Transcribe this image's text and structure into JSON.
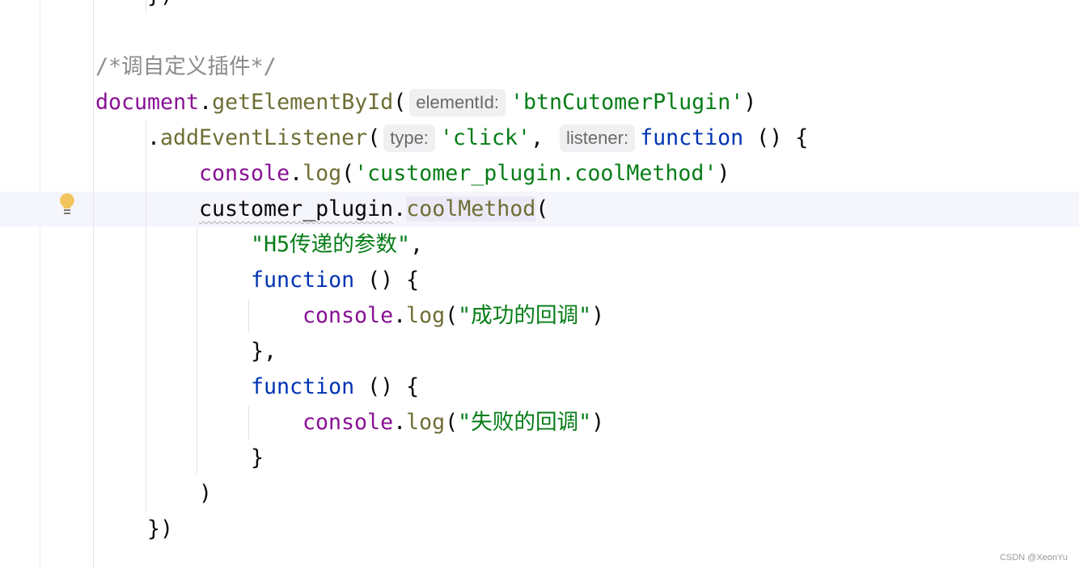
{
  "editor": {
    "current_line_index": 5,
    "lines": [
      {
        "indent": 1,
        "tokens": [
          {
            "t": "})",
            "c": ""
          }
        ]
      },
      {
        "indent": 0,
        "tokens": []
      },
      {
        "indent": 0,
        "tokens": [
          {
            "t": "/*调自定义插件*/",
            "c": "cm"
          }
        ]
      },
      {
        "indent": 0,
        "tokens": [
          {
            "t": "document",
            "c": "obj"
          },
          {
            "t": ".",
            "c": ""
          },
          {
            "t": "getElementById",
            "c": "fn"
          },
          {
            "t": "(",
            "c": ""
          },
          {
            "t": "elementId:",
            "c": "hint"
          },
          {
            "t": "'btnCutomerPlugin'",
            "c": "str"
          },
          {
            "t": ")",
            "c": ""
          }
        ]
      },
      {
        "indent": 1,
        "tokens": [
          {
            "t": ".",
            "c": ""
          },
          {
            "t": "addEventListener",
            "c": "fn"
          },
          {
            "t": "(",
            "c": ""
          },
          {
            "t": "type:",
            "c": "hint"
          },
          {
            "t": "'click'",
            "c": "str"
          },
          {
            "t": ", ",
            "c": ""
          },
          {
            "t": "listener:",
            "c": "hint"
          },
          {
            "t": "function",
            "c": "kw"
          },
          {
            "t": " () {",
            "c": ""
          }
        ]
      },
      {
        "indent": 2,
        "tokens": [
          {
            "t": "console",
            "c": "obj"
          },
          {
            "t": ".",
            "c": ""
          },
          {
            "t": "log",
            "c": "fn"
          },
          {
            "t": "(",
            "c": ""
          },
          {
            "t": "'customer_plugin.coolMethod'",
            "c": "str"
          },
          {
            "t": ")",
            "c": ""
          }
        ]
      },
      {
        "indent": 2,
        "tokens": [
          {
            "t": "customer_plugin",
            "c": "wavy"
          },
          {
            "t": ".",
            "c": ""
          },
          {
            "t": "coolMethod",
            "c": "fn hl"
          },
          {
            "t": "(",
            "c": ""
          }
        ]
      },
      {
        "indent": 3,
        "tokens": [
          {
            "t": "\"H5传递的参数\"",
            "c": "str"
          },
          {
            "t": ",",
            "c": ""
          }
        ]
      },
      {
        "indent": 3,
        "tokens": [
          {
            "t": "function",
            "c": "kw"
          },
          {
            "t": " () {",
            "c": ""
          }
        ]
      },
      {
        "indent": 4,
        "tokens": [
          {
            "t": "console",
            "c": "obj"
          },
          {
            "t": ".",
            "c": ""
          },
          {
            "t": "log",
            "c": "fn"
          },
          {
            "t": "(",
            "c": ""
          },
          {
            "t": "\"成功的回调\"",
            "c": "str"
          },
          {
            "t": ")",
            "c": ""
          }
        ]
      },
      {
        "indent": 3,
        "tokens": [
          {
            "t": "},",
            "c": ""
          }
        ]
      },
      {
        "indent": 3,
        "tokens": [
          {
            "t": "function",
            "c": "kw"
          },
          {
            "t": " () {",
            "c": ""
          }
        ]
      },
      {
        "indent": 4,
        "tokens": [
          {
            "t": "console",
            "c": "obj"
          },
          {
            "t": ".",
            "c": ""
          },
          {
            "t": "log",
            "c": "fn"
          },
          {
            "t": "(",
            "c": ""
          },
          {
            "t": "\"失败的回调\"",
            "c": "str"
          },
          {
            "t": ")",
            "c": ""
          }
        ]
      },
      {
        "indent": 3,
        "tokens": [
          {
            "t": "}",
            "c": ""
          }
        ]
      },
      {
        "indent": 2,
        "tokens": [
          {
            "t": ")",
            "c": ""
          }
        ]
      },
      {
        "indent": 1,
        "tokens": [
          {
            "t": "})",
            "c": ""
          }
        ]
      }
    ],
    "intention_icon": "lightbulb-icon",
    "colors": {
      "keyword": "#0033b3",
      "object": "#871094",
      "function": "#6e6e35",
      "string": "#067d17",
      "comment": "#8c8c8c",
      "current_line": "#f5f5fc"
    }
  },
  "watermark": "CSDN @XeonYu"
}
